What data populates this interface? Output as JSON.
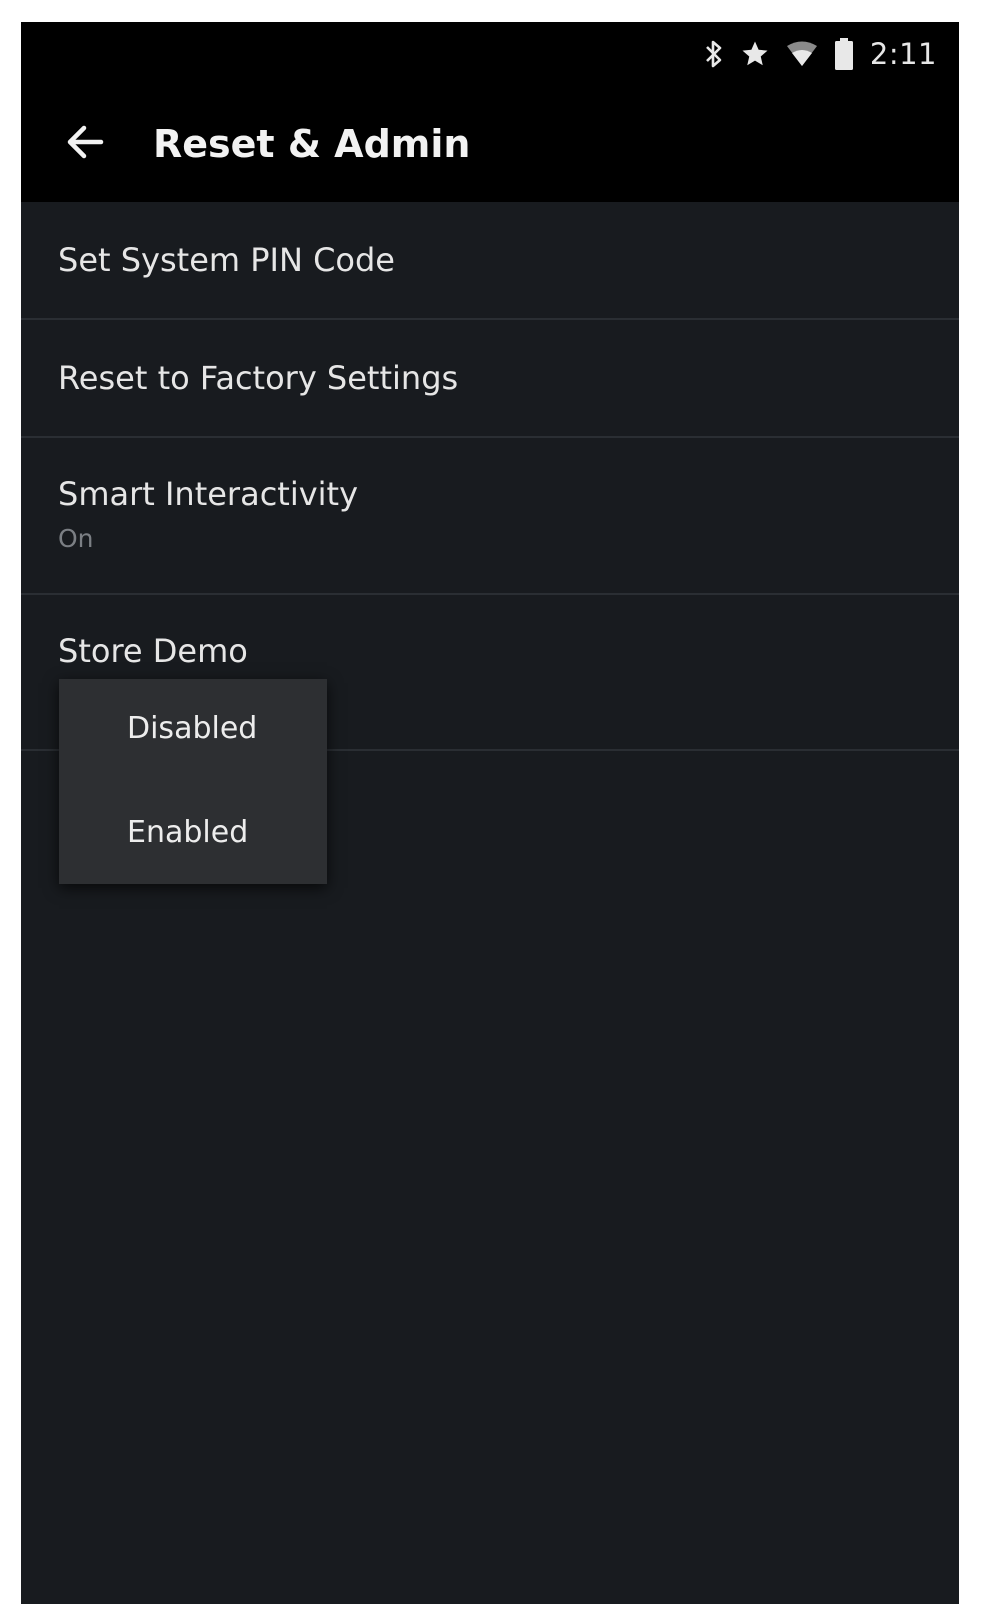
{
  "status_bar": {
    "icons": [
      "bluetooth-icon",
      "star-icon",
      "wifi-icon",
      "battery-icon"
    ],
    "time": "2:11"
  },
  "app_bar": {
    "back_icon": "arrow-back-icon",
    "title": "Reset & Admin"
  },
  "settings": {
    "items": [
      {
        "title": "Set System PIN Code"
      },
      {
        "title": "Reset to Factory Settings"
      },
      {
        "title": "Smart Interactivity",
        "value": "On"
      },
      {
        "title": "Store Demo"
      }
    ]
  },
  "store_demo_menu": {
    "options": [
      "Disabled",
      "Enabled"
    ]
  },
  "colors": {
    "background": "#181b1f",
    "bars": "#000000",
    "popup": "#2d2f32",
    "primary_text": "#e6e6e6",
    "secondary_text": "#7b7f84"
  }
}
